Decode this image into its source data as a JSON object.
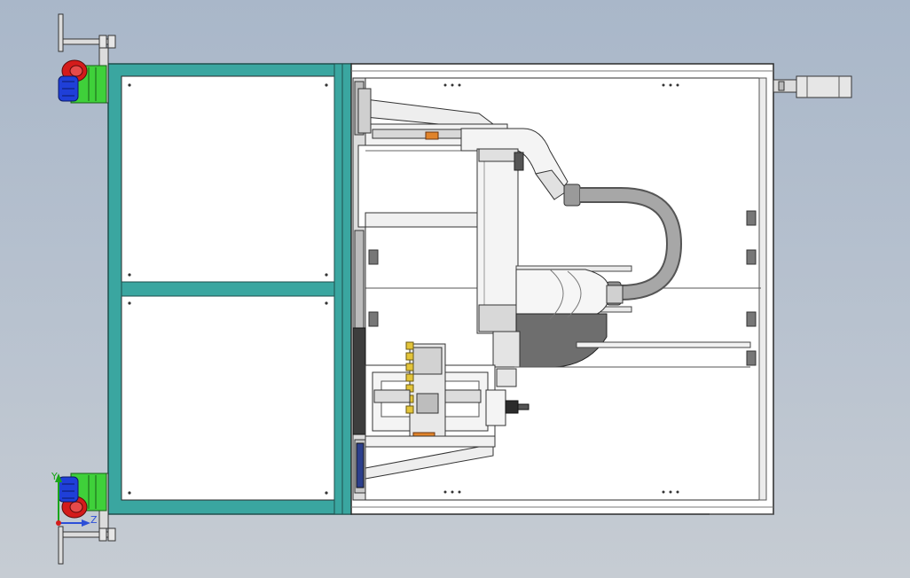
{
  "viewport": {
    "background_top": "#a9b7c9",
    "background_bottom": "#c6ccd3"
  },
  "colors": {
    "frame_teal": "#3aa6a0",
    "frame_dark": "#1f6f6a",
    "panel_white": "#ffffff",
    "line_dark": "#2b2b2b",
    "caster_green": "#3fd03a",
    "caster_blue": "#1f3fd8",
    "caster_red": "#d41b1b",
    "hose_gray": "#8e8e8e",
    "motor_gray": "#6e6e6e",
    "yellow_clamp": "#e3c43a",
    "orange_tag": "#e0832a"
  },
  "triad": {
    "labels": [
      "Y",
      "Z"
    ],
    "colors": {
      "y": "#1aa51a",
      "z": "#2c4fd8",
      "x": "#d41b1b"
    }
  }
}
